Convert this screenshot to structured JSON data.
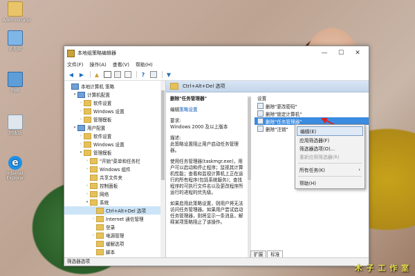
{
  "desktop": {
    "icons": [
      {
        "label": "Administrator",
        "icon": "user-folder-icon"
      },
      {
        "label": "此电脑",
        "icon": "computer-icon"
      },
      {
        "label": "网络",
        "icon": "network-icon"
      },
      {
        "label": "回收站",
        "icon": "recycle-bin-icon"
      },
      {
        "label": "Internet Explorer",
        "icon": "ie-icon"
      }
    ],
    "watermark": "木 子 工 作 室"
  },
  "window": {
    "title": "本地组策略编辑器",
    "controls": {
      "minimize": "—",
      "maximize": "☐",
      "close": "✕"
    }
  },
  "menubar": [
    "文件(F)",
    "操作(A)",
    "查看(V)",
    "帮助(H)"
  ],
  "tree": [
    {
      "label": "本地计算机 策略",
      "depth": 0,
      "expander": "",
      "icon": "pc"
    },
    {
      "label": "计算机配置",
      "depth": 1,
      "expander": "▾",
      "icon": "pc"
    },
    {
      "label": "软件设置",
      "depth": 2,
      "expander": "›",
      "icon": "folder"
    },
    {
      "label": "Windows 设置",
      "depth": 2,
      "expander": "›",
      "icon": "folder"
    },
    {
      "label": "管理模板",
      "depth": 2,
      "expander": "›",
      "icon": "folder"
    },
    {
      "label": "用户配置",
      "depth": 1,
      "expander": "▾",
      "icon": "pc"
    },
    {
      "label": "软件设置",
      "depth": 2,
      "expander": "›",
      "icon": "folder"
    },
    {
      "label": "Windows 设置",
      "depth": 2,
      "expander": "›",
      "icon": "folder"
    },
    {
      "label": "管理模板",
      "depth": 2,
      "expander": "▾",
      "icon": "folder"
    },
    {
      "label": "\"开始\"菜单和任务栏",
      "depth": 3,
      "expander": "›",
      "icon": "folder"
    },
    {
      "label": "Windows 组件",
      "depth": 3,
      "expander": "›",
      "icon": "folder"
    },
    {
      "label": "共享文件夹",
      "depth": 3,
      "expander": "",
      "icon": "folder"
    },
    {
      "label": "控制面板",
      "depth": 3,
      "expander": "›",
      "icon": "folder"
    },
    {
      "label": "网络",
      "depth": 3,
      "expander": "›",
      "icon": "folder"
    },
    {
      "label": "系统",
      "depth": 3,
      "expander": "▾",
      "icon": "folder"
    },
    {
      "label": "Ctrl+Alt+Del 选项",
      "depth": 4,
      "expander": "",
      "icon": "folder",
      "selected": true
    },
    {
      "label": "Internet 通信管理",
      "depth": 4,
      "expander": "›",
      "icon": "folder"
    },
    {
      "label": "登录",
      "depth": 4,
      "expander": "",
      "icon": "folder"
    },
    {
      "label": "电源管理",
      "depth": 4,
      "expander": "›",
      "icon": "folder"
    },
    {
      "label": "缓解选项",
      "depth": 4,
      "expander": "",
      "icon": "folder"
    },
    {
      "label": "脚本",
      "depth": 4,
      "expander": "",
      "icon": "folder"
    }
  ],
  "right_header": "Ctrl+Alt+Del 选项",
  "description": {
    "title": "删除\"任务管理器\"",
    "edit_prefix": "编辑",
    "edit_link": "策略设置",
    "req_label": "要求:",
    "req_value": "Windows 2000 及以上版本",
    "desc_label": "描述:",
    "desc_value": "此策略设置阻止用户启动任务管理器。",
    "para1": "使用任务管理器(taskmgr.exe)，用户可以启动和停止程序；监视其计算机性能；查看和监视计算机上正在运行的所有程序(包括系统服务)；查找程序的可执行文件名以及更改程序所运行的进程的优先级。",
    "para2": "如果启用此策略设置，则用户将无法访问任务管理器。如果用户尝试启动任务管理器，则将显示一条消息，解释某项策略阻止了该操作。"
  },
  "settings": {
    "header": "设置",
    "items": [
      {
        "label": "删除\"更改密码\""
      },
      {
        "label": "删除\"锁定计算机\""
      },
      {
        "label": "删除\"任务管理器\"",
        "selected": true
      },
      {
        "label": "删除\"注销\""
      }
    ]
  },
  "context_menu": [
    {
      "label": "编辑(E)",
      "highlighted": true
    },
    {
      "label": "应用筛选器(F)"
    },
    {
      "label": "筛选器选项(O)..."
    },
    {
      "label": "重新应用筛选器(R)",
      "disabled": true
    },
    {
      "separator": true
    },
    {
      "label": "所有任务(K)",
      "submenu": true
    },
    {
      "separator": true
    },
    {
      "label": "帮助(H)"
    }
  ],
  "tabs": [
    {
      "label": "扩展",
      "active": false
    },
    {
      "label": "标准",
      "active": true
    }
  ],
  "status": "筛选器选项"
}
